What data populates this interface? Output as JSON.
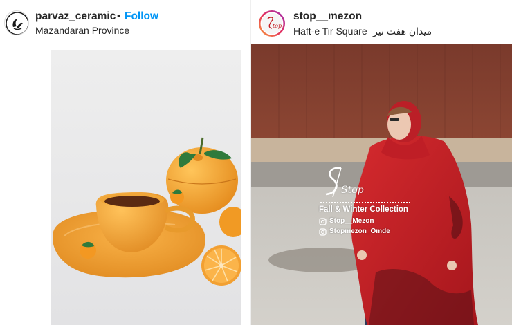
{
  "left_post": {
    "username": "parvaz_ceramic",
    "separator": "•",
    "follow_label": "Follow",
    "location": "Mazandaran Province",
    "avatar_icon": "ceramic-logo-icon",
    "image_subject": "orange-ceramic-cup-and-saucer-photo"
  },
  "right_post": {
    "username": "stop__mezon",
    "location": "Haft-e Tir Square",
    "location_native": "میدان هفت تیر",
    "avatar_icon": "stop-logo-icon",
    "overlay": {
      "logo_text": "Stop",
      "collection": "Fall & Winter Collection",
      "handle_1": "Stop__Mezon",
      "handle_2": "Stopmezon_Omde"
    }
  },
  "colors": {
    "follow": "#0095f6",
    "text": "#262626",
    "divider": "#efefef",
    "ceramic_orange": "#f0a030",
    "shawl_red": "#c41e24"
  }
}
